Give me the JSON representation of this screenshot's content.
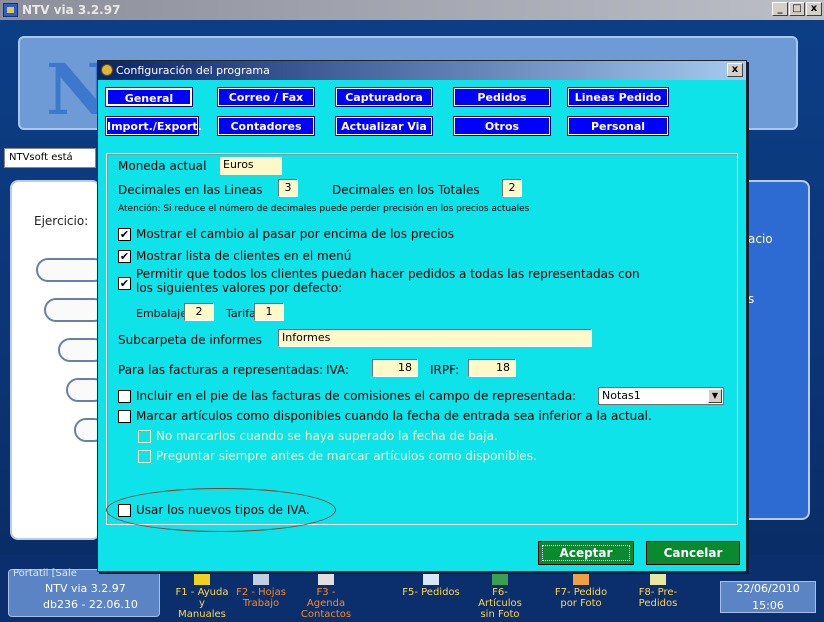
{
  "window": {
    "title": "NTV via 3.2.97"
  },
  "background": {
    "info_strip": "NTVsoft está",
    "ejercicio_label": "Ejercicio:",
    "right_text_1": "acio",
    "right_text_2": "s",
    "status": {
      "label": "Portatil [Sale",
      "version": "NTV via  3.2.97",
      "db": "db236 - 22.06.10"
    },
    "fkeys": [
      {
        "label": "F1 - Ayuda y Manuales"
      },
      {
        "label": "F2 - Hojas Trabajo"
      },
      {
        "label": "F3 - Agenda Contactos"
      },
      {
        "label": "F5- Pedidos"
      },
      {
        "label": "F6- Artículos sin Foto"
      },
      {
        "label": "F7- Pedido por Foto"
      },
      {
        "label": "F8- Pre-Pedidos"
      }
    ],
    "date": "22/06/2010",
    "time": "15:06"
  },
  "dialog": {
    "title": "Configuración del programa",
    "close_label": "x",
    "tabs_row1": [
      "General",
      "Correo / Fax",
      "Capturadora",
      "Pedidos",
      "Lineas Pedido"
    ],
    "tabs_row2": [
      "Import./Export.",
      "Contadores",
      "Actualizar Via",
      "Otros",
      "Personal"
    ],
    "moneda_label": "Moneda actual",
    "moneda_value": "Euros",
    "decimales_lineas_label": "Decimales en las Lineas",
    "decimales_lineas_value": "3",
    "decimales_totales_label": "Decimales en los Totales",
    "decimales_totales_value": "2",
    "atencion": "Atención: Si reduce el número de decimales puede perder precisión en los precios actuales",
    "chk_mostrar_cambio": "Mostrar el cambio al pasar por encima de los precios",
    "chk_mostrar_lista": "Mostrar lista de clientes en el menú",
    "chk_permitir_1": "Permitir que todos los clientes puedan hacer pedidos a todas las representadas con",
    "chk_permitir_2": "los siguientes valores por defecto:",
    "embalaje_label": "Embalaje",
    "embalaje_value": "2",
    "tarifa_label": "Tarifa",
    "tarifa_value": "1",
    "subcarpeta_label": "Subcarpeta de informes",
    "subcarpeta_value": "Informes",
    "facturas_label": "Para las facturas a representadas:",
    "iva_label": "IVA:",
    "iva_value": "18",
    "irpf_label": "IRPF:",
    "irpf_value": "18",
    "chk_incluir": "Incluir en el pie de las facturas de comisiones el campo de representada:",
    "select_value": "Notas1",
    "chk_marcar": "Marcar artículos como disponibles cuando la fecha de entrada sea inferior a la actual.",
    "chk_no_marcarlos": "No marcarlos cuando se haya superado la fecha de baja.",
    "chk_preguntar": "Preguntar siempre antes de marcar artículos como disponibles.",
    "chk_nuevos_iva": "Usar los nuevos tipos de IVA.",
    "checked_mark": "✔",
    "accept_label": "Aceptar",
    "cancel_label": "Cancelar"
  }
}
